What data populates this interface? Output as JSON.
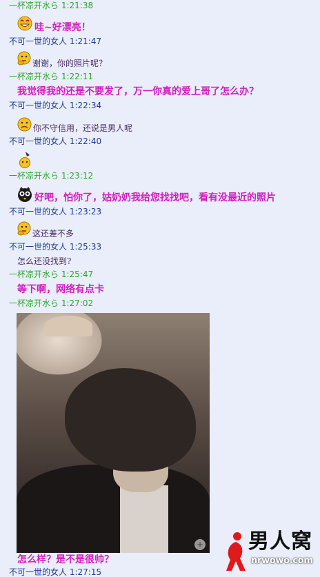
{
  "chat": {
    "messages": [
      {
        "sender": "一杯凉开水ら",
        "time": "1:21:38",
        "who": "friend"
      },
      {
        "text": "哇~好漂亮！",
        "icon": "grin-emoticon"
      },
      {
        "sender": "不可一世的女人",
        "time": "1:21:47",
        "who": "self"
      },
      {
        "text": "谢谢，你的照片呢？",
        "icon": "thinking-emoticon"
      },
      {
        "sender": "一杯凉开水ら",
        "time": "1:22:11",
        "who": "friend"
      },
      {
        "text": "我觉得我的还是不要发了，万一你真的爱上哥了怎么办？"
      },
      {
        "sender": "不可一世的女人",
        "time": "1:22:34",
        "who": "self"
      },
      {
        "text": "你不守信用，还说是男人呢",
        "icon": "confused-emoticon"
      },
      {
        "sender": "不可一世的女人",
        "time": "1:22:40",
        "who": "self"
      },
      {
        "icon": "sweat-emoticon"
      },
      {
        "sender": "一杯凉开水ら",
        "time": "1:23:12",
        "who": "friend"
      },
      {
        "text": "好吧，怕你了，姑奶奶我给您找找吧，看有没最近的照片",
        "icon": "owl-emoticon"
      },
      {
        "sender": "不可一世的女人",
        "time": "1:23:23",
        "who": "self"
      },
      {
        "text": "这还差不多",
        "icon": "thinking-emoticon"
      },
      {
        "sender": "不可一世的女人",
        "time": "1:25:33",
        "who": "self"
      },
      {
        "text": "怎么还没找到?"
      },
      {
        "sender": "一杯凉开水ら",
        "time": "1:25:47",
        "who": "friend"
      },
      {
        "text": "等下啊，网络有点卡"
      },
      {
        "sender": "一杯凉开水ら",
        "time": "1:27:02",
        "who": "friend"
      },
      {
        "text": "怎么样？是不是很帅？"
      },
      {
        "sender": "不可一世的女人",
        "time": "1:27:15",
        "who": "self"
      }
    ]
  },
  "watermark": {
    "brand": "男人窝",
    "url": "nrwowo.com"
  },
  "colors": {
    "background": "#e9eefa",
    "friend_header": "#2aa52a",
    "self_header": "#1e3c96",
    "big_text": "#d41dbf",
    "small_text": "#4a2a66"
  }
}
